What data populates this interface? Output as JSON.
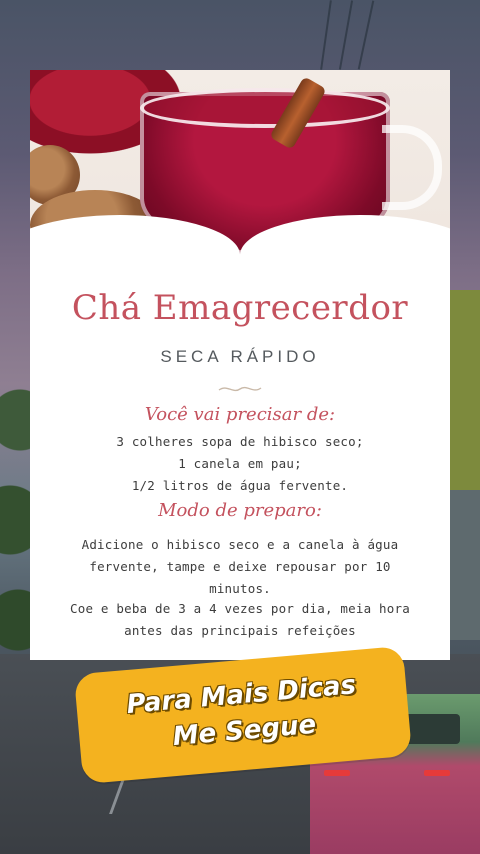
{
  "card": {
    "title": "Chá Emagrecerdor",
    "subtitle": "SECA RÁPIDO",
    "ingredients_heading": "Você vai precisar de:",
    "ingredients": [
      "3 colheres sopa de hibisco seco;",
      "1 canela em pau;",
      "1/2 litros de água fervente."
    ],
    "method_heading": "Modo de preparo:",
    "method": [
      "Adicione o hibisco seco e a canela à água",
      "fervente, tampe e deixe repousar por 10",
      "minutos.",
      "Coe e beba de 3 a 4 vezes por dia, meia hora",
      "antes das principais refeições"
    ]
  },
  "cta": {
    "line1": "Para Mais Dicas",
    "line2": "Me Segue"
  },
  "colors": {
    "accent": "#c4525e",
    "cta_bg": "#f4b21f"
  }
}
